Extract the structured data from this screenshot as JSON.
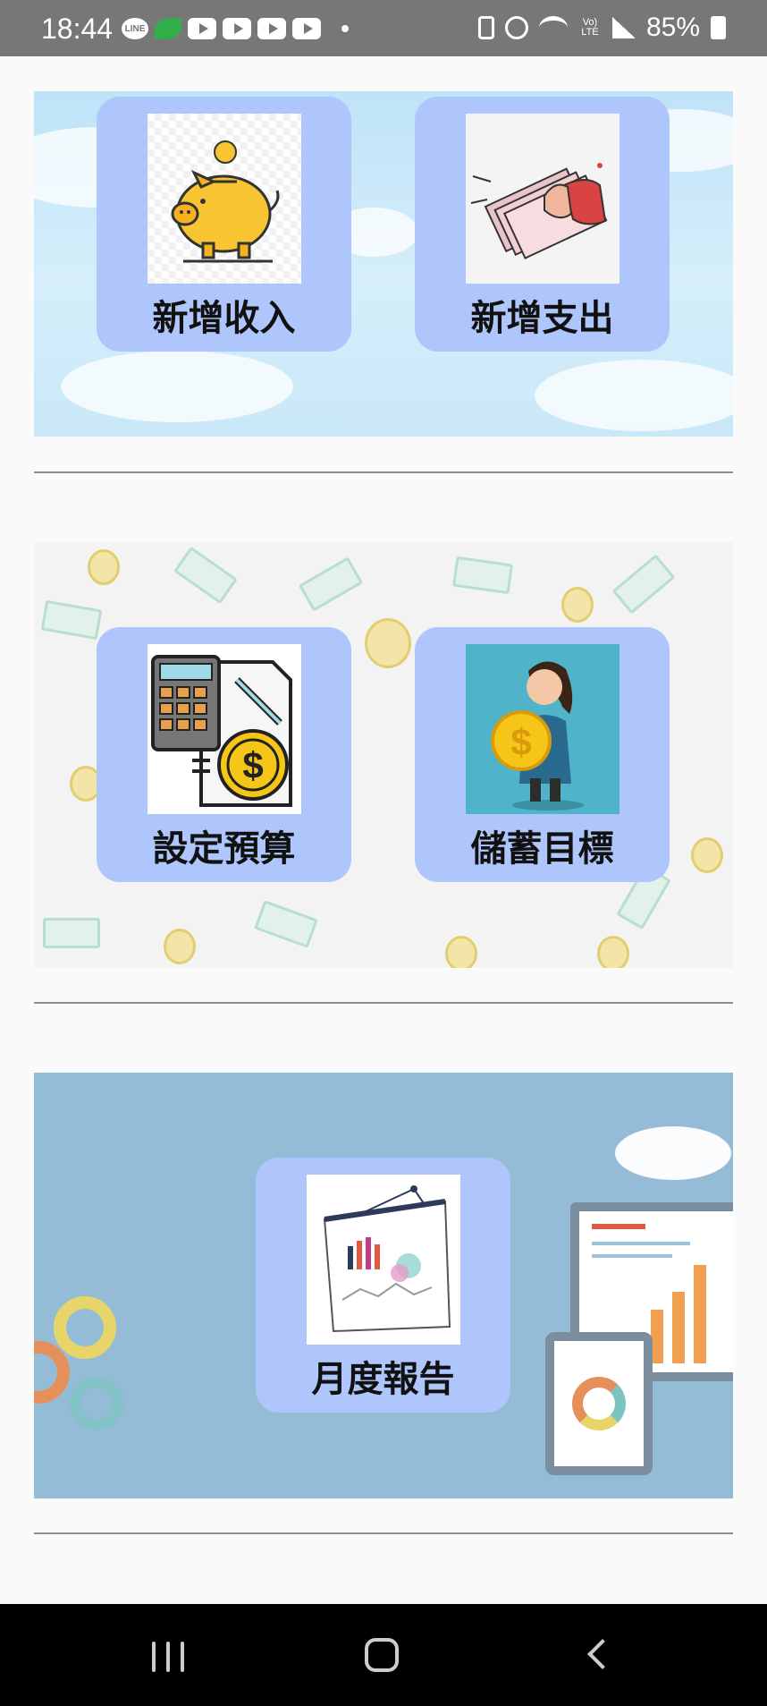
{
  "status_bar": {
    "time": "18:44",
    "battery_percent": "85%",
    "volte_label": "Vo) LTE",
    "line_label": "LINE",
    "left_icons": [
      "line-icon",
      "leaf-icon",
      "youtube-icon",
      "youtube-icon",
      "youtube-icon",
      "youtube-icon",
      "dot-icon"
    ],
    "right_icons": [
      "battery-saver-icon",
      "alarm-icon",
      "wifi-icon",
      "volte-icon",
      "signal-icon",
      "battery-icon"
    ]
  },
  "sections": {
    "income_expense": {
      "add_income_label": "新增收入",
      "add_expense_label": "新增支出",
      "add_income_icon": "piggy-bank-icon",
      "add_expense_icon": "cash-in-hand-icon"
    },
    "budget_goal": {
      "set_budget_label": "設定預算",
      "savings_goal_label": "儲蓄目標",
      "set_budget_icon": "calculator-coin-icon",
      "savings_goal_icon": "woman-holding-coin-icon"
    },
    "report": {
      "monthly_report_label": "月度報告",
      "monthly_report_icon": "presentation-chart-icon"
    }
  },
  "nav_bar": {
    "buttons": [
      "recent-apps",
      "home",
      "back"
    ]
  },
  "colors": {
    "card": "#aec6fb",
    "status_bar": "#777777",
    "nav_bar": "#000000",
    "divider": "#8c8c8c",
    "report_bg": "#94bcd7"
  }
}
